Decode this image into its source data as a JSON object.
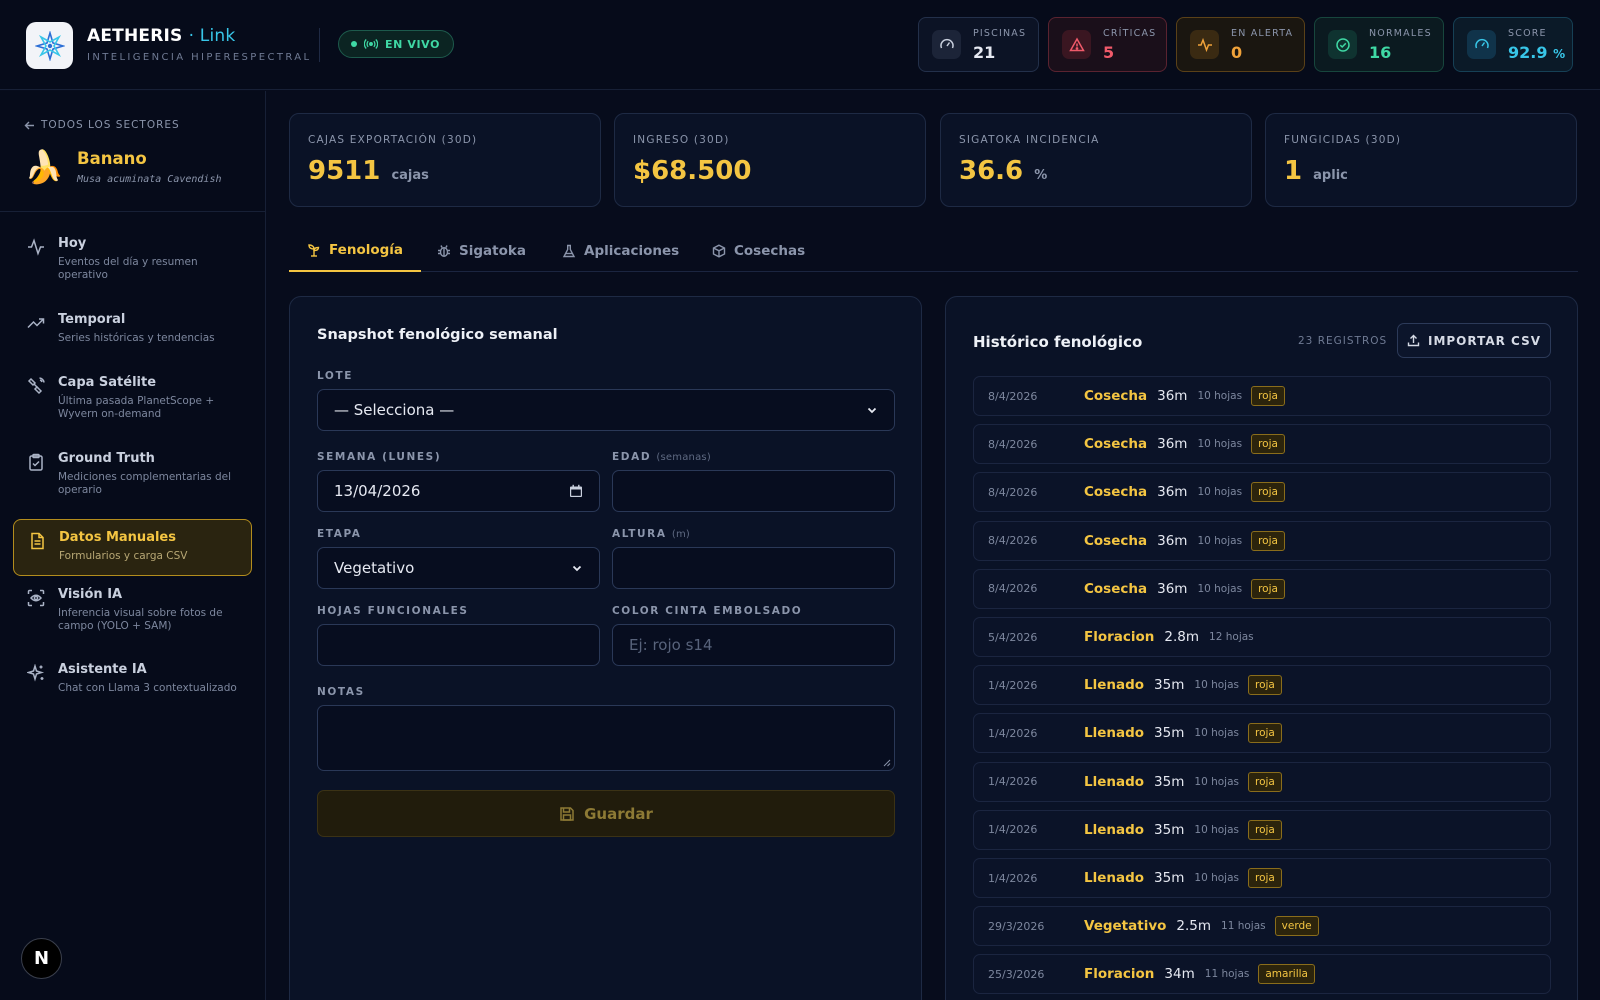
{
  "header": {
    "brand_name": "AETHERIS",
    "brand_accent": "· Link",
    "brand_sub": "INTELIGENCIA HIPERESPECTRAL",
    "live_label": "EN VIVO",
    "stats": [
      {
        "label": "PISCINAS",
        "value": "21",
        "color": "#e6e9f2",
        "icon": "gauge-icon"
      },
      {
        "label": "CRÍTICAS",
        "value": "5",
        "color": "#f05a6a",
        "icon": "warning-icon"
      },
      {
        "label": "EN ALERTA",
        "value": "0",
        "color": "#f0a23a",
        "icon": "pulse-icon"
      },
      {
        "label": "NORMALES",
        "value": "16",
        "color": "#3fd8a4",
        "icon": "check-circle-icon"
      },
      {
        "label": "SCORE",
        "value": "92.9",
        "unit": "%",
        "color": "#38c6e8",
        "icon": "speedometer-icon"
      }
    ]
  },
  "sidebar": {
    "back_label": "TODOS LOS SECTORES",
    "sector_emoji": "🍌",
    "sector_name": "Banano",
    "sector_sub": "Musa acuminata Cavendish",
    "items": [
      {
        "title": "Hoy",
        "desc": "Eventos del día y resumen operativo",
        "icon": "activity-icon"
      },
      {
        "title": "Temporal",
        "desc": "Series históricas y tendencias",
        "icon": "trending-up-icon"
      },
      {
        "title": "Capa Satélite",
        "desc": "Última pasada PlanetScope + Wyvern on-demand",
        "icon": "satellite-icon"
      },
      {
        "title": "Ground Truth",
        "desc": "Mediciones complementarias del operario",
        "icon": "clipboard-check-icon"
      },
      {
        "title": "Datos Manuales",
        "desc": "Formularios y carga CSV",
        "icon": "file-text-icon"
      },
      {
        "title": "Visión IA",
        "desc": "Inferencia visual sobre fotos de campo (YOLO + SAM)",
        "icon": "scan-eye-icon"
      },
      {
        "title": "Asistente IA",
        "desc": "Chat con Llama 3 contextualizado",
        "icon": "sparkles-icon"
      }
    ],
    "badge": "N"
  },
  "kpis": [
    {
      "label": "CAJAS EXPORTACIÓN (30D)",
      "value": "9511",
      "unit": "cajas"
    },
    {
      "label": "INGRESO (30D)",
      "value": "$68.500",
      "unit": ""
    },
    {
      "label": "SIGATOKA INCIDENCIA",
      "value": "36.6",
      "unit": "%"
    },
    {
      "label": "FUNGICIDAS (30D)",
      "value": "1",
      "unit": "aplic"
    }
  ],
  "tabs": [
    {
      "label": "Fenología",
      "icon": "sprout-icon"
    },
    {
      "label": "Sigatoka",
      "icon": "bug-icon"
    },
    {
      "label": "Aplicaciones",
      "icon": "flask-icon"
    },
    {
      "label": "Cosechas",
      "icon": "package-icon"
    }
  ],
  "form": {
    "title": "Snapshot fenológico semanal",
    "lote_label": "LOTE",
    "lote_value": "— Selecciona —",
    "semana_label": "SEMANA (LUNES)",
    "semana_value": "13/04/2026",
    "edad_label": "EDAD",
    "edad_hint": "(semanas)",
    "etapa_label": "ETAPA",
    "etapa_value": "Vegetativo",
    "altura_label": "ALTURA",
    "altura_hint": "(m)",
    "hojas_label": "HOJAS FUNCIONALES",
    "cinta_label": "COLOR CINTA EMBOLSADO",
    "cinta_placeholder": "Ej: rojo s14",
    "notas_label": "NOTAS",
    "save_label": "Guardar"
  },
  "history": {
    "title": "Histórico fenológico",
    "count": "23 REGISTROS",
    "import_label": "IMPORTAR CSV",
    "rows": [
      {
        "date": "8/4/2026",
        "stage": "Cosecha",
        "height": "36m",
        "leaves": "10 hojas",
        "tag": "roja"
      },
      {
        "date": "8/4/2026",
        "stage": "Cosecha",
        "height": "36m",
        "leaves": "10 hojas",
        "tag": "roja"
      },
      {
        "date": "8/4/2026",
        "stage": "Cosecha",
        "height": "36m",
        "leaves": "10 hojas",
        "tag": "roja"
      },
      {
        "date": "8/4/2026",
        "stage": "Cosecha",
        "height": "36m",
        "leaves": "10 hojas",
        "tag": "roja"
      },
      {
        "date": "8/4/2026",
        "stage": "Cosecha",
        "height": "36m",
        "leaves": "10 hojas",
        "tag": "roja"
      },
      {
        "date": "5/4/2026",
        "stage": "Floracion",
        "height": "2.8m",
        "leaves": "12 hojas",
        "tag": ""
      },
      {
        "date": "1/4/2026",
        "stage": "Llenado",
        "height": "35m",
        "leaves": "10 hojas",
        "tag": "roja"
      },
      {
        "date": "1/4/2026",
        "stage": "Llenado",
        "height": "35m",
        "leaves": "10 hojas",
        "tag": "roja"
      },
      {
        "date": "1/4/2026",
        "stage": "Llenado",
        "height": "35m",
        "leaves": "10 hojas",
        "tag": "roja"
      },
      {
        "date": "1/4/2026",
        "stage": "Llenado",
        "height": "35m",
        "leaves": "10 hojas",
        "tag": "roja"
      },
      {
        "date": "1/4/2026",
        "stage": "Llenado",
        "height": "35m",
        "leaves": "10 hojas",
        "tag": "roja"
      },
      {
        "date": "29/3/2026",
        "stage": "Vegetativo",
        "height": "2.5m",
        "leaves": "11 hojas",
        "tag": "verde"
      },
      {
        "date": "25/3/2026",
        "stage": "Floracion",
        "height": "34m",
        "leaves": "11 hojas",
        "tag": "amarilla"
      }
    ]
  }
}
